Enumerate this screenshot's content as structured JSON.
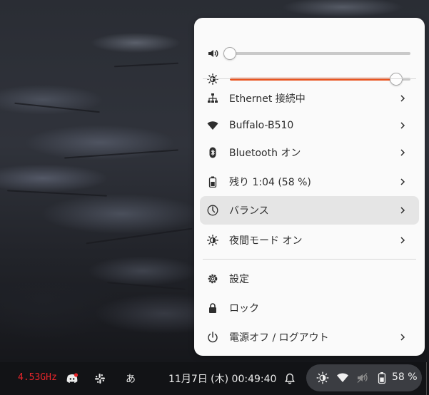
{
  "quick_settings": {
    "volume": {
      "icon": "speaker-icon",
      "level": 0.0
    },
    "brightness": {
      "icon": "brightness-icon",
      "level": 0.92
    },
    "items": [
      {
        "icon": "network-wired-icon",
        "label": "Ethernet 接続中",
        "has_submenu": true
      },
      {
        "icon": "wifi-icon",
        "label": "Buffalo-B510",
        "has_submenu": true
      },
      {
        "icon": "bluetooth-icon",
        "label": "Bluetooth オン",
        "has_submenu": true
      },
      {
        "icon": "battery-icon",
        "label": "残り 1:04 (58 %)",
        "has_submenu": true
      },
      {
        "icon": "power-profile-icon",
        "label": "バランス",
        "has_submenu": true,
        "highlighted": true
      },
      {
        "icon": "night-light-icon",
        "label": "夜間モード オン",
        "has_submenu": true
      },
      {
        "icon": "settings-icon",
        "label": "設定",
        "has_submenu": false
      },
      {
        "icon": "lock-icon",
        "label": "ロック",
        "has_submenu": false
      },
      {
        "icon": "power-icon",
        "label": "電源オフ / ログアウト",
        "has_submenu": true
      }
    ]
  },
  "taskbar": {
    "cpu_freq": "4.53GHz",
    "ime_indicator": "あ",
    "clock": "11月7日 (木)  00:49:40",
    "battery_percent": "58 %"
  },
  "colors": {
    "accent": "#e95420",
    "popup_bg": "#fafafa",
    "panel_bg": "#121316",
    "cpu_text": "#e8252a"
  }
}
